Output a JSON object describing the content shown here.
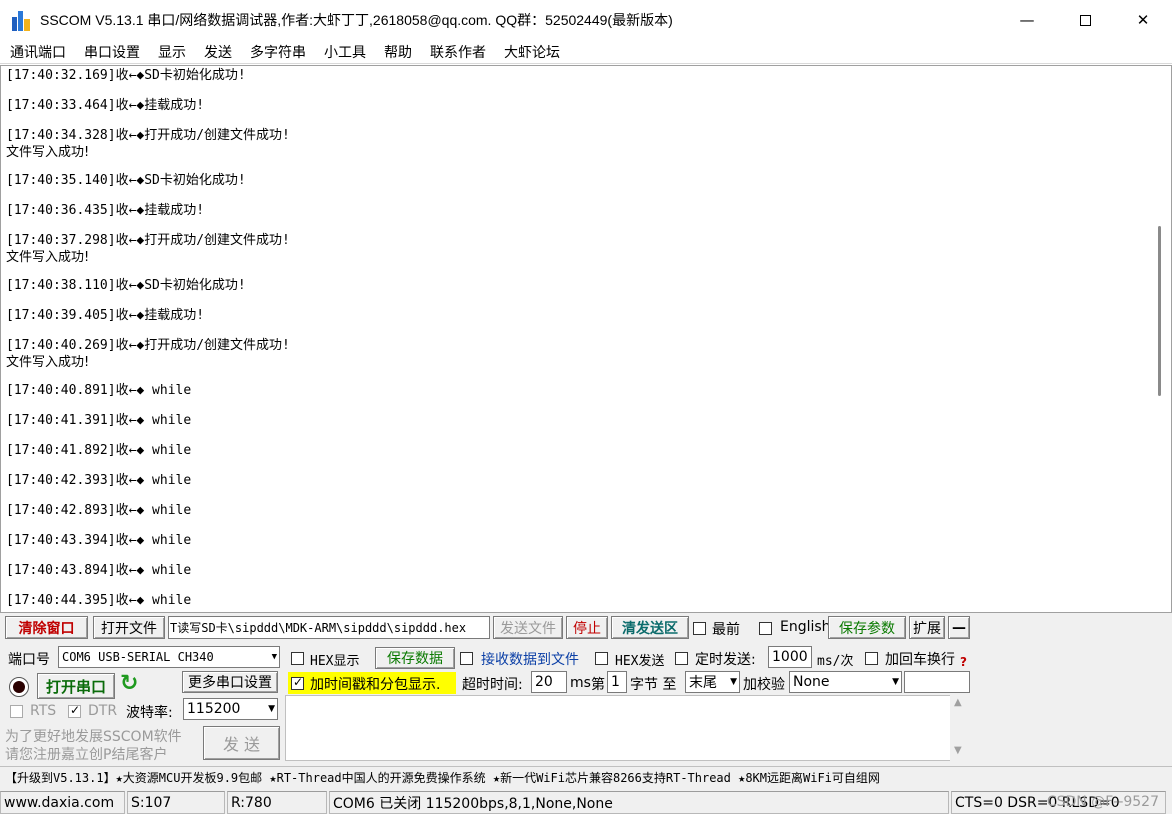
{
  "window": {
    "title": "SSCOM V5.13.1 串口/网络数据调试器,作者:大虾丁丁,2618058@qq.com. QQ群：52502449(最新版本)",
    "minimize": "—",
    "close": "✕"
  },
  "menu": [
    "通讯端口",
    "串口设置",
    "显示",
    "发送",
    "多字符串",
    "小工具",
    "帮助",
    "联系作者",
    "大虾论坛"
  ],
  "log": [
    {
      "text": "[17:40:32.169]收←◆SD卡初始化成功!"
    },
    {
      "text": "[17:40:33.464]收←◆挂载成功!"
    },
    {
      "text": "[17:40:34.328]收←◆打开成功/创建文件成功!",
      "cont": "文件写入成功!"
    },
    {
      "text": "[17:40:35.140]收←◆SD卡初始化成功!"
    },
    {
      "text": "[17:40:36.435]收←◆挂载成功!"
    },
    {
      "text": "[17:40:37.298]收←◆打开成功/创建文件成功!",
      "cont": "文件写入成功!"
    },
    {
      "text": "[17:40:38.110]收←◆SD卡初始化成功!"
    },
    {
      "text": "[17:40:39.405]收←◆挂载成功!"
    },
    {
      "text": "[17:40:40.269]收←◆打开成功/创建文件成功!",
      "cont": "文件写入成功!"
    },
    {
      "text": "[17:40:40.891]收←◆ while"
    },
    {
      "text": "[17:40:41.391]收←◆ while"
    },
    {
      "text": "[17:40:41.892]收←◆ while"
    },
    {
      "text": "[17:40:42.393]收←◆ while"
    },
    {
      "text": "[17:40:42.893]收←◆ while"
    },
    {
      "text": "[17:40:43.394]收←◆ while"
    },
    {
      "text": "[17:40:43.894]收←◆ while"
    },
    {
      "text": "[17:40:44.395]收←◆ while"
    }
  ],
  "toolbar": {
    "clear_window": "清除窗口",
    "open_file": "打开文件",
    "file_path": "T读写SD卡\\sipddd\\MDK-ARM\\sipddd\\sipddd.hex",
    "send_file": "发送文件",
    "stop": "停止",
    "clear_send": "清发送区",
    "topmost": "最前",
    "english": "English",
    "save_params": "保存参数",
    "expand": "扩展",
    "collapse": "—"
  },
  "port": {
    "label": "端口号",
    "value": "COM6 USB-SERIAL CH340",
    "open_button": "打开串口",
    "more_settings": "更多串口设置",
    "rts": "RTS",
    "dtr": "DTR",
    "baud_label": "波特率:",
    "baud_value": "115200",
    "promo_text_1": "为了更好地发展SSCOM软件",
    "promo_text_2": "请您注册嘉立创P结尾客户",
    "send_button": "发  送"
  },
  "options": {
    "hex_display": "HEX显示",
    "save_data": "保存数据",
    "recv_to_file": "接收数据到文件",
    "hex_send": "HEX发送",
    "timed_send": "定时发送:",
    "timed_value": "1000",
    "timed_unit": "ms/次",
    "append_newline": "加回车换行",
    "help_mark": "?",
    "timestamp": "加时间戳和分包显示.",
    "timeout_label": "超时时间:",
    "timeout_value": "20",
    "timeout_unit": "ms",
    "nth_label": "第",
    "nth_value": "1",
    "byte_label": "字节 至",
    "end_value": "末尾",
    "checksum_label": "加校验",
    "checksum_value": "None"
  },
  "promo_bar": "【升级到V5.13.1】★大资源MCU开发板9.9包邮 ★RT-Thread中国人的开源免费操作系统 ★新一代WiFi芯片兼容8266支持RT-Thread ★8KM远距离WiFi可自组网",
  "status": {
    "url": "www.daxia.com",
    "sent": "S:107",
    "received": "R:780",
    "port_info": "COM6 已关闭  115200bps,8,1,None,None",
    "lines": "CTS=0 DSR=0 RLSD=0",
    "watermark": "CSDN @F--9527"
  },
  "colors": {
    "accent_red": "#c00000",
    "accent_green": "#0a7a00",
    "accent_blue": "#0b3fa6",
    "highlight_yellow": "#ffff00"
  }
}
